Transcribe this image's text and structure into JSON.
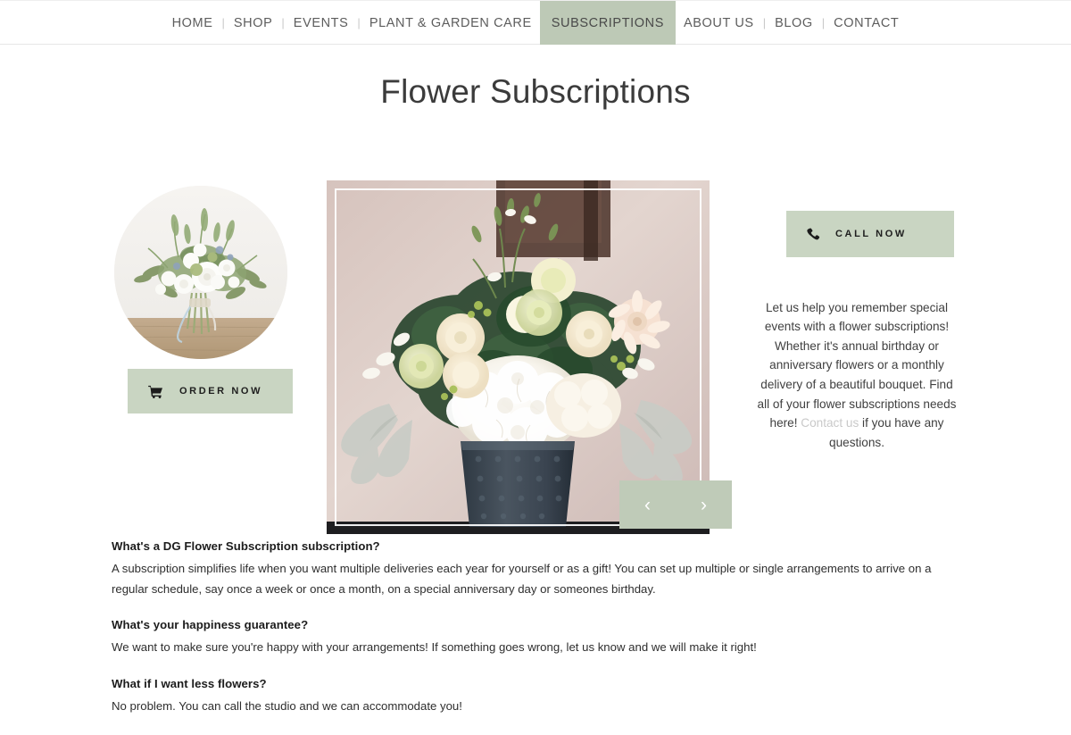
{
  "nav": {
    "items": [
      {
        "label": "HOME",
        "active": false
      },
      {
        "label": "SHOP",
        "active": false
      },
      {
        "label": "EVENTS",
        "active": false
      },
      {
        "label": "PLANT & GARDEN CARE",
        "active": false
      },
      {
        "label": "SUBSCRIPTIONS",
        "active": true
      },
      {
        "label": "ABOUT US",
        "active": false
      },
      {
        "label": "BLOG",
        "active": false
      },
      {
        "label": "CONTACT",
        "active": false
      }
    ],
    "separator": "|",
    "active_bg": "#bdc9b6"
  },
  "header": {
    "title": "Flower Subscriptions"
  },
  "left": {
    "circle_image_alt": "white and green bridal bouquet on wooden table",
    "order_button": {
      "label": "ORDER NOW",
      "icon": "shopping-cart-icon",
      "bg": "#c9d5c2"
    }
  },
  "carousel": {
    "image_alt": "cream and white floral arrangement in dark textured vase",
    "prev_arrow": "‹",
    "next_arrow": "›",
    "nav_bg": "#bfcbb8"
  },
  "right": {
    "call_button": {
      "label": "CALL NOW",
      "icon": "phone-icon",
      "bg": "#c9d5c2"
    },
    "copy_before_link": "Let us help you remember special events with a flower subscriptions! Whether it's annual birthday or anniversary flowers or a monthly delivery of a beautiful bouquet. Find all of your flower subscriptions needs here! ",
    "contact_link_label": "Contact us",
    "copy_after_link": " if you have any questions.",
    "link_color": "#c9c9c9"
  },
  "faq": [
    {
      "question": "What's a DG Flower Subscription subscription?",
      "answer": "A subscription simplifies life when you want multiple deliveries each year for yourself or as a gift! You can set up multiple or single arrangements to arrive on a regular schedule, say once a week or once a month, on a special anniversary day or someones birthday."
    },
    {
      "question": "What's your happiness guarantee?",
      "answer": "We want to make sure you're happy with your arrangements! If something goes wrong, let us know and we will make it right!"
    },
    {
      "question": "What if I want less flowers?",
      "answer": "No problem. You can call the studio and we can accommodate you!"
    }
  ]
}
